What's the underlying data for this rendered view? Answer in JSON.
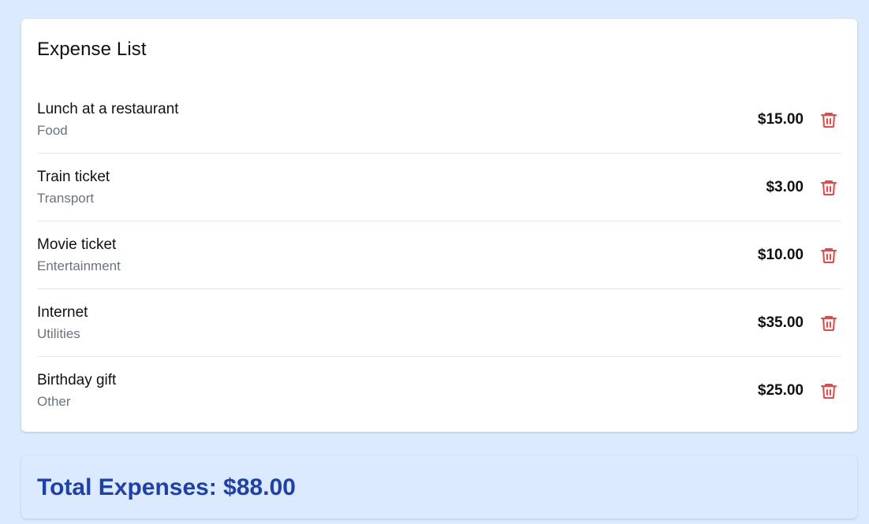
{
  "expense_list": {
    "title": "Expense List",
    "items": [
      {
        "name": "Lunch at a restaurant",
        "category": "Food",
        "amount": "$15.00"
      },
      {
        "name": "Train ticket",
        "category": "Transport",
        "amount": "$3.00"
      },
      {
        "name": "Movie ticket",
        "category": "Entertainment",
        "amount": "$10.00"
      },
      {
        "name": "Internet",
        "category": "Utilities",
        "amount": "$35.00"
      },
      {
        "name": "Birthday gift",
        "category": "Other",
        "amount": "$25.00"
      }
    ]
  },
  "total": {
    "text": "Total Expenses: $88.00"
  },
  "icons": {
    "delete": "trash-icon"
  },
  "colors": {
    "background": "#dbeafe",
    "card": "#ffffff",
    "delete_icon": "#ef4444",
    "total_text": "#1e40af",
    "category_text": "#6b7280"
  }
}
